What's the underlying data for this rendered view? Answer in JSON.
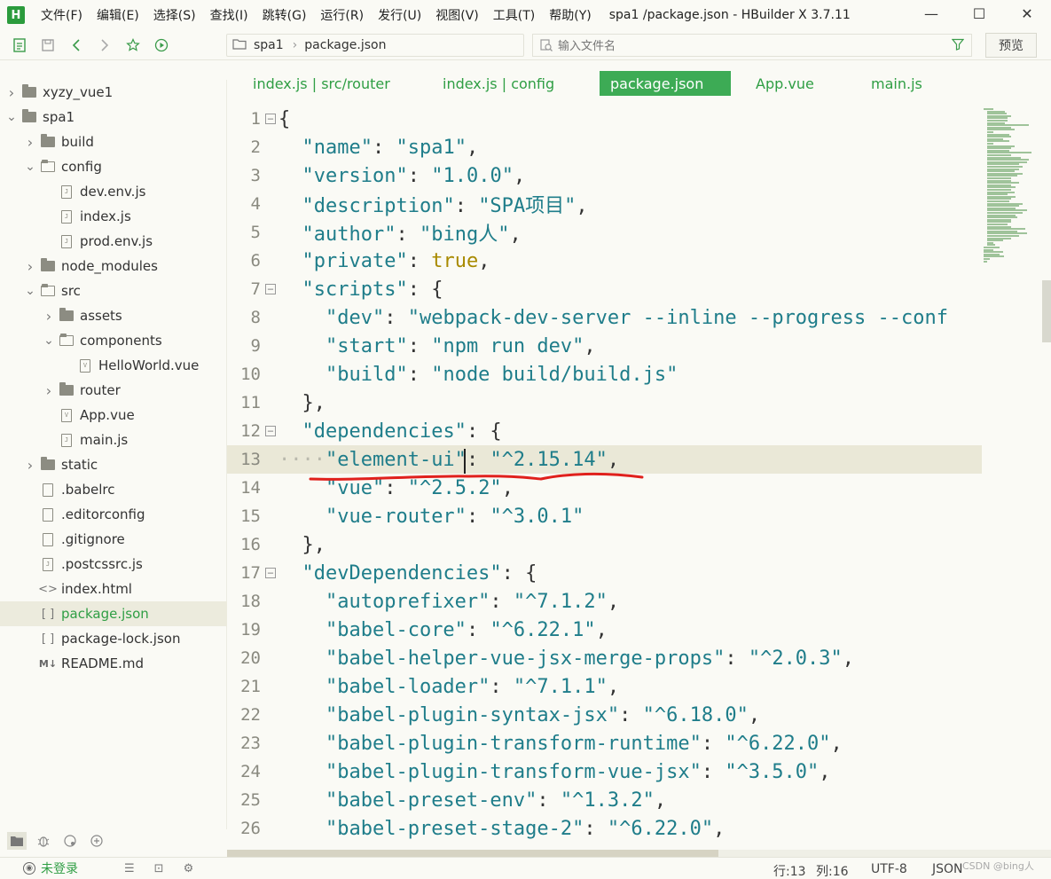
{
  "app": {
    "logo_letter": "H",
    "menu": [
      "文件(F)",
      "编辑(E)",
      "选择(S)",
      "查找(I)",
      "跳转(G)",
      "运行(R)",
      "发行(U)",
      "视图(V)",
      "工具(T)",
      "帮助(Y)"
    ],
    "window_title": "spa1  /package.json - HBuilder X 3.7.11",
    "controls": {
      "minimize": "—",
      "maximize": "☐",
      "close": "✕"
    }
  },
  "toolbar": {
    "breadcrumb": [
      "spa1",
      "package.json"
    ],
    "file_search_placeholder": "输入文件名",
    "preview_label": "预览"
  },
  "sidebar": {
    "tree": [
      {
        "label": "xyzy_vue1",
        "kind": "project",
        "indent": 0,
        "caret": "right"
      },
      {
        "label": "spa1",
        "kind": "project",
        "indent": 0,
        "caret": "down"
      },
      {
        "label": "build",
        "kind": "folder",
        "indent": 1,
        "caret": "right"
      },
      {
        "label": "config",
        "kind": "folder-open",
        "indent": 1,
        "caret": "down"
      },
      {
        "label": "dev.env.js",
        "kind": "file-js",
        "indent": 2,
        "caret": ""
      },
      {
        "label": "index.js",
        "kind": "file-js",
        "indent": 2,
        "caret": ""
      },
      {
        "label": "prod.env.js",
        "kind": "file-js",
        "indent": 2,
        "caret": ""
      },
      {
        "label": "node_modules",
        "kind": "folder",
        "indent": 1,
        "caret": "right"
      },
      {
        "label": "src",
        "kind": "folder-open",
        "indent": 1,
        "caret": "down"
      },
      {
        "label": "assets",
        "kind": "folder",
        "indent": 2,
        "caret": "right"
      },
      {
        "label": "components",
        "kind": "folder-open",
        "indent": 2,
        "caret": "down"
      },
      {
        "label": "HelloWorld.vue",
        "kind": "file-vue",
        "indent": 3,
        "caret": ""
      },
      {
        "label": "router",
        "kind": "folder",
        "indent": 2,
        "caret": "right"
      },
      {
        "label": "App.vue",
        "kind": "file-vue",
        "indent": 2,
        "caret": ""
      },
      {
        "label": "main.js",
        "kind": "file-js",
        "indent": 2,
        "caret": ""
      },
      {
        "label": "static",
        "kind": "folder",
        "indent": 1,
        "caret": "right"
      },
      {
        "label": ".babelrc",
        "kind": "file",
        "indent": 1,
        "caret": ""
      },
      {
        "label": ".editorconfig",
        "kind": "file",
        "indent": 1,
        "caret": ""
      },
      {
        "label": ".gitignore",
        "kind": "file",
        "indent": 1,
        "caret": ""
      },
      {
        "label": ".postcssrc.js",
        "kind": "file-js",
        "indent": 1,
        "caret": ""
      },
      {
        "label": "index.html",
        "kind": "file-html",
        "indent": 1,
        "caret": ""
      },
      {
        "label": "package.json",
        "kind": "file-json",
        "indent": 1,
        "caret": "",
        "selected": true
      },
      {
        "label": "package-lock.json",
        "kind": "file-json",
        "indent": 1,
        "caret": ""
      },
      {
        "label": "README.md",
        "kind": "file-md",
        "indent": 1,
        "caret": ""
      }
    ]
  },
  "tabs": [
    {
      "label": "index.js | src/router",
      "active": false
    },
    {
      "label": "index.js | config",
      "active": false
    },
    {
      "label": "package.json",
      "active": true
    },
    {
      "label": "App.vue",
      "active": false
    },
    {
      "label": "main.js",
      "active": false
    }
  ],
  "editor": {
    "current_line": 13,
    "lines": [
      {
        "n": "1",
        "fold": true,
        "tokens": [
          [
            "punc",
            "{"
          ]
        ]
      },
      {
        "n": "2",
        "fold": false,
        "tokens": [
          [
            "ws",
            "  "
          ],
          [
            "key",
            "\"name\""
          ],
          [
            "punc",
            ": "
          ],
          [
            "str",
            "\"spa1\""
          ],
          [
            "punc",
            ","
          ]
        ]
      },
      {
        "n": "3",
        "fold": false,
        "tokens": [
          [
            "ws",
            "  "
          ],
          [
            "key",
            "\"version\""
          ],
          [
            "punc",
            ": "
          ],
          [
            "str",
            "\"1.0.0\""
          ],
          [
            "punc",
            ","
          ]
        ]
      },
      {
        "n": "4",
        "fold": false,
        "tokens": [
          [
            "ws",
            "  "
          ],
          [
            "key",
            "\"description\""
          ],
          [
            "punc",
            ": "
          ],
          [
            "str",
            "\"SPA项目\""
          ],
          [
            "punc",
            ","
          ]
        ]
      },
      {
        "n": "5",
        "fold": false,
        "tokens": [
          [
            "ws",
            "  "
          ],
          [
            "key",
            "\"author\""
          ],
          [
            "punc",
            ": "
          ],
          [
            "str",
            "\"bing人\""
          ],
          [
            "punc",
            ","
          ]
        ]
      },
      {
        "n": "6",
        "fold": false,
        "tokens": [
          [
            "ws",
            "  "
          ],
          [
            "key",
            "\"private\""
          ],
          [
            "punc",
            ": "
          ],
          [
            "kw",
            "true"
          ],
          [
            "punc",
            ","
          ]
        ]
      },
      {
        "n": "7",
        "fold": true,
        "tokens": [
          [
            "ws",
            "  "
          ],
          [
            "key",
            "\"scripts\""
          ],
          [
            "punc",
            ": {"
          ]
        ]
      },
      {
        "n": "8",
        "fold": false,
        "tokens": [
          [
            "ws",
            "    "
          ],
          [
            "key",
            "\"dev\""
          ],
          [
            "punc",
            ": "
          ],
          [
            "str",
            "\"webpack-dev-server --inline --progress --conf"
          ]
        ]
      },
      {
        "n": "9",
        "fold": false,
        "tokens": [
          [
            "ws",
            "    "
          ],
          [
            "key",
            "\"start\""
          ],
          [
            "punc",
            ": "
          ],
          [
            "str",
            "\"npm run dev\""
          ],
          [
            "punc",
            ","
          ]
        ]
      },
      {
        "n": "10",
        "fold": false,
        "tokens": [
          [
            "ws",
            "    "
          ],
          [
            "key",
            "\"build\""
          ],
          [
            "punc",
            ": "
          ],
          [
            "str",
            "\"node build/build.js\""
          ]
        ]
      },
      {
        "n": "11",
        "fold": false,
        "tokens": [
          [
            "ws",
            "  "
          ],
          [
            "punc",
            "},"
          ]
        ]
      },
      {
        "n": "12",
        "fold": true,
        "tokens": [
          [
            "ws",
            "  "
          ],
          [
            "key",
            "\"dependencies\""
          ],
          [
            "punc",
            ": {"
          ]
        ]
      },
      {
        "n": "13",
        "fold": false,
        "tokens": [
          [
            "ws",
            "····"
          ],
          [
            "key",
            "\"element-ui\""
          ],
          [
            "punc",
            ": "
          ],
          [
            "str",
            "\"^2.15.14\""
          ],
          [
            "punc",
            ","
          ]
        ]
      },
      {
        "n": "14",
        "fold": false,
        "tokens": [
          [
            "ws",
            "    "
          ],
          [
            "key",
            "\"vue\""
          ],
          [
            "punc",
            ": "
          ],
          [
            "str",
            "\"^2.5.2\""
          ],
          [
            "punc",
            ","
          ]
        ]
      },
      {
        "n": "15",
        "fold": false,
        "tokens": [
          [
            "ws",
            "    "
          ],
          [
            "key",
            "\"vue-router\""
          ],
          [
            "punc",
            ": "
          ],
          [
            "str",
            "\"^3.0.1\""
          ]
        ]
      },
      {
        "n": "16",
        "fold": false,
        "tokens": [
          [
            "ws",
            "  "
          ],
          [
            "punc",
            "},"
          ]
        ]
      },
      {
        "n": "17",
        "fold": true,
        "tokens": [
          [
            "ws",
            "  "
          ],
          [
            "key",
            "\"devDependencies\""
          ],
          [
            "punc",
            ": {"
          ]
        ]
      },
      {
        "n": "18",
        "fold": false,
        "tokens": [
          [
            "ws",
            "    "
          ],
          [
            "key",
            "\"autoprefixer\""
          ],
          [
            "punc",
            ": "
          ],
          [
            "str",
            "\"^7.1.2\""
          ],
          [
            "punc",
            ","
          ]
        ]
      },
      {
        "n": "19",
        "fold": false,
        "tokens": [
          [
            "ws",
            "    "
          ],
          [
            "key",
            "\"babel-core\""
          ],
          [
            "punc",
            ": "
          ],
          [
            "str",
            "\"^6.22.1\""
          ],
          [
            "punc",
            ","
          ]
        ]
      },
      {
        "n": "20",
        "fold": false,
        "tokens": [
          [
            "ws",
            "    "
          ],
          [
            "key",
            "\"babel-helper-vue-jsx-merge-props\""
          ],
          [
            "punc",
            ": "
          ],
          [
            "str",
            "\"^2.0.3\""
          ],
          [
            "punc",
            ","
          ]
        ]
      },
      {
        "n": "21",
        "fold": false,
        "tokens": [
          [
            "ws",
            "    "
          ],
          [
            "key",
            "\"babel-loader\""
          ],
          [
            "punc",
            ": "
          ],
          [
            "str",
            "\"^7.1.1\""
          ],
          [
            "punc",
            ","
          ]
        ]
      },
      {
        "n": "22",
        "fold": false,
        "tokens": [
          [
            "ws",
            "    "
          ],
          [
            "key",
            "\"babel-plugin-syntax-jsx\""
          ],
          [
            "punc",
            ": "
          ],
          [
            "str",
            "\"^6.18.0\""
          ],
          [
            "punc",
            ","
          ]
        ]
      },
      {
        "n": "23",
        "fold": false,
        "tokens": [
          [
            "ws",
            "    "
          ],
          [
            "key",
            "\"babel-plugin-transform-runtime\""
          ],
          [
            "punc",
            ": "
          ],
          [
            "str",
            "\"^6.22.0\""
          ],
          [
            "punc",
            ","
          ]
        ]
      },
      {
        "n": "24",
        "fold": false,
        "tokens": [
          [
            "ws",
            "    "
          ],
          [
            "key",
            "\"babel-plugin-transform-vue-jsx\""
          ],
          [
            "punc",
            ": "
          ],
          [
            "str",
            "\"^3.5.0\""
          ],
          [
            "punc",
            ","
          ]
        ]
      },
      {
        "n": "25",
        "fold": false,
        "tokens": [
          [
            "ws",
            "    "
          ],
          [
            "key",
            "\"babel-preset-env\""
          ],
          [
            "punc",
            ": "
          ],
          [
            "str",
            "\"^1.3.2\""
          ],
          [
            "punc",
            ","
          ]
        ]
      },
      {
        "n": "26",
        "fold": false,
        "tokens": [
          [
            "ws",
            "    "
          ],
          [
            "key",
            "\"babel-preset-stage-2\""
          ],
          [
            "punc",
            ": "
          ],
          [
            "str",
            "\"^6.22.0\""
          ],
          [
            "punc",
            ","
          ]
        ]
      }
    ]
  },
  "statusbar": {
    "login": "未登录",
    "position_line": "行:13",
    "position_col": "列:16",
    "encoding": "UTF-8",
    "language": "JSON",
    "watermark": "CSDN @bing人"
  },
  "colors": {
    "accent": "#3dab55",
    "key": "#1f7d8a",
    "keyword": "#a88a00",
    "annotation": "#e0201c"
  }
}
